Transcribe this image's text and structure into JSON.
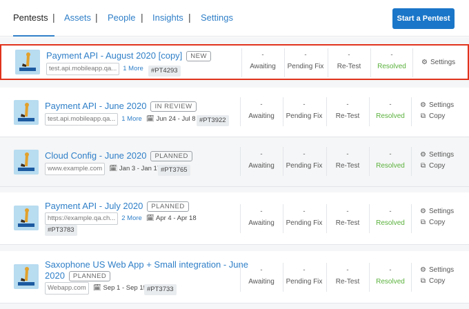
{
  "nav": {
    "tabs": [
      {
        "label": "Pentests",
        "active": true
      },
      {
        "label": "Assets"
      },
      {
        "label": "People"
      },
      {
        "label": "Insights"
      },
      {
        "label": "Settings"
      }
    ],
    "separator": "|",
    "cta_label": "Start a Pentest"
  },
  "stats_labels": {
    "dash": "-",
    "awaiting": "Awaiting",
    "pending_fix": "Pending Fix",
    "retest": "Re-Test",
    "resolved": "Resolved"
  },
  "actions": {
    "settings": "Settings",
    "copy": "Copy"
  },
  "icons": {
    "settings": "gear-icon",
    "copy": "copy-icon",
    "calendar": "calendar-icon"
  },
  "colors": {
    "accent": "#1a76c8",
    "link": "#2f7fc8",
    "resolved": "#5ab13c",
    "highlight": "#e0321c"
  },
  "pentests": [
    {
      "title": "Payment API - August 2020 [copy]",
      "badge": "NEW",
      "asset": "test.api.mobileapp.qa...",
      "more": "1 More",
      "date": "",
      "code": "#PT4293"
    },
    {
      "title": "Payment API - June 2020",
      "badge": "IN REVIEW",
      "asset": "test.api.mobileapp.qa...",
      "more": "1 More",
      "date": "Jun 24 - Jul 8",
      "code": "#PT3922"
    },
    {
      "title": "Cloud Config - June 2020",
      "badge": "PLANNED",
      "asset": "www.example.com",
      "more": "",
      "date": "Jan 3 - Jan 17",
      "code": "#PT3765"
    },
    {
      "title": "Payment API - July 2020",
      "badge": "PLANNED",
      "asset": "https://example.qa.ch...",
      "more": "2 More",
      "date": "Apr 4 - Apr 18",
      "code": "#PT3783"
    },
    {
      "title_line1": "Saxophone US Web App + Small integration - June",
      "title_line2": "2020",
      "badge": "PLANNED",
      "asset": "Webapp.com",
      "more": "",
      "date": "Sep 1 - Sep 15",
      "code": "#PT3733"
    }
  ]
}
